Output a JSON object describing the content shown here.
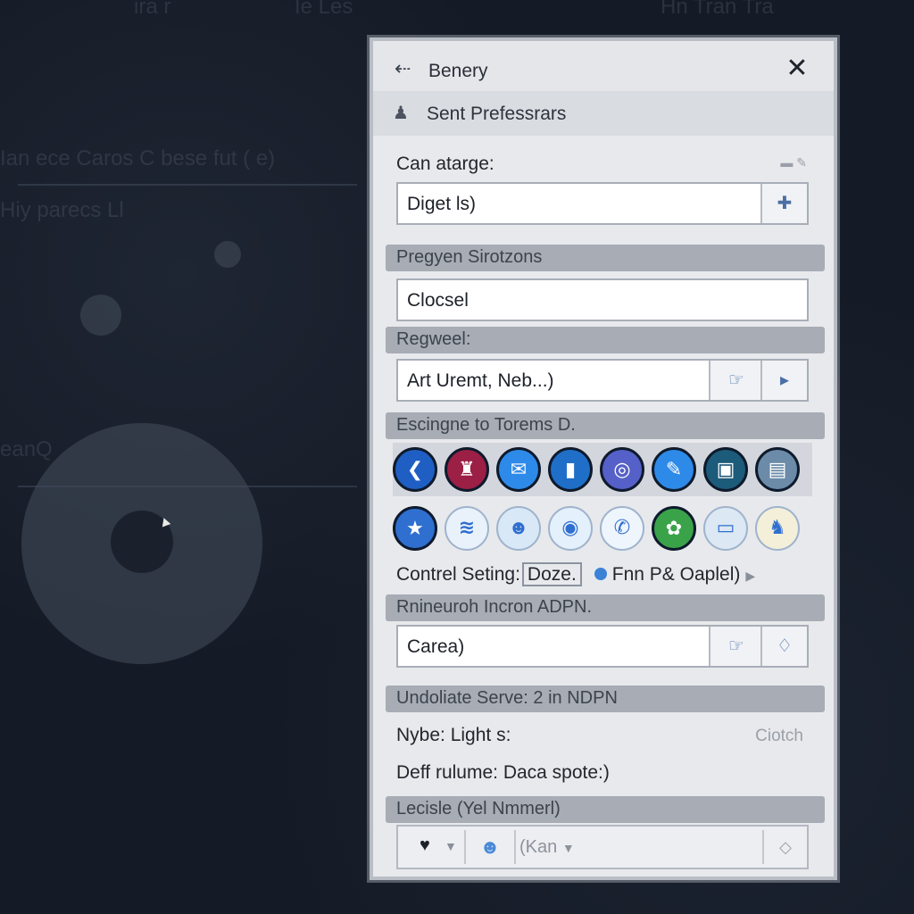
{
  "background": {
    "texts": [
      "ira r",
      "Ie Les",
      "Hn Tran Tra",
      "Ian ece Caros C bese fut ( e)",
      "Hiy parecs Ll",
      "eanQ"
    ]
  },
  "dialog": {
    "back_icon": "arrow-left-icon",
    "title": "Benery",
    "close_icon": "close-icon",
    "subtitle": "Sent Prefessrars",
    "can_atarge_label": "Can atarge:",
    "digest_value": "Diget ls)",
    "digest_btn_icon": "plus-cross-icon",
    "section1": "Pregyen Sirotzons",
    "closel_value": "Clocsel",
    "section2": "Regweel:",
    "art_value": "Art Uremt, Neb...)",
    "section3": "Escingne to Torems D.",
    "icons_row1": [
      {
        "name": "chevron-left-app-icon",
        "glyph": "❮",
        "color": "#1f5fc4"
      },
      {
        "name": "red-bag-app-icon",
        "glyph": "♜",
        "color": "#9c1f45"
      },
      {
        "name": "chat-bubble-app-icon",
        "glyph": "✉",
        "color": "#2e8ae8"
      },
      {
        "name": "phone-app-icon",
        "glyph": "▮",
        "color": "#1f6fc8"
      },
      {
        "name": "ring-app-icon",
        "glyph": "◎",
        "color": "#5560c8"
      },
      {
        "name": "pen-app-icon",
        "glyph": "✎",
        "color": "#2e8ae8"
      },
      {
        "name": "document-app-icon",
        "glyph": "▣",
        "color": "#1d5b7a"
      },
      {
        "name": "gallery-app-icon",
        "glyph": "▤",
        "color": "#6b8ba8"
      }
    ],
    "icons_row2": [
      {
        "name": "star-app-icon",
        "glyph": "★",
        "color": "#2f6fd0"
      },
      {
        "name": "wifi-app-icon",
        "glyph": "≋",
        "color": "#e9f2fb"
      },
      {
        "name": "character-app-icon",
        "glyph": "☻",
        "color": "#d9e8f7"
      },
      {
        "name": "search-app-icon",
        "glyph": "◉",
        "color": "#e4f0fb"
      },
      {
        "name": "phone-call-app-icon",
        "glyph": "✆",
        "color": "#eef5fc"
      },
      {
        "name": "flower-app-icon",
        "glyph": "✿",
        "color": "#3aa34a"
      },
      {
        "name": "monitor-app-icon",
        "glyph": "▭",
        "color": "#dce8f3"
      },
      {
        "name": "pet-app-icon",
        "glyph": "♞",
        "color": "#f4efd8"
      }
    ],
    "control_label": "Contrel Seting:",
    "control_value": "Doze.",
    "fnn_label": "Fnn P& Oaplel)",
    "section4": "Rnineuroh Incron ADPN.",
    "carea_value": "Carea)",
    "section5": "Undoliate Serve: 2 in NDPN",
    "nybe_label": "Nybe: Light s:",
    "nybe_value": "Ciotch",
    "deff_label": "Deff rulume: Daca spote:)",
    "section6": "Lecisle (Yel Nmmerl)",
    "bottom_text": "(Kan"
  }
}
